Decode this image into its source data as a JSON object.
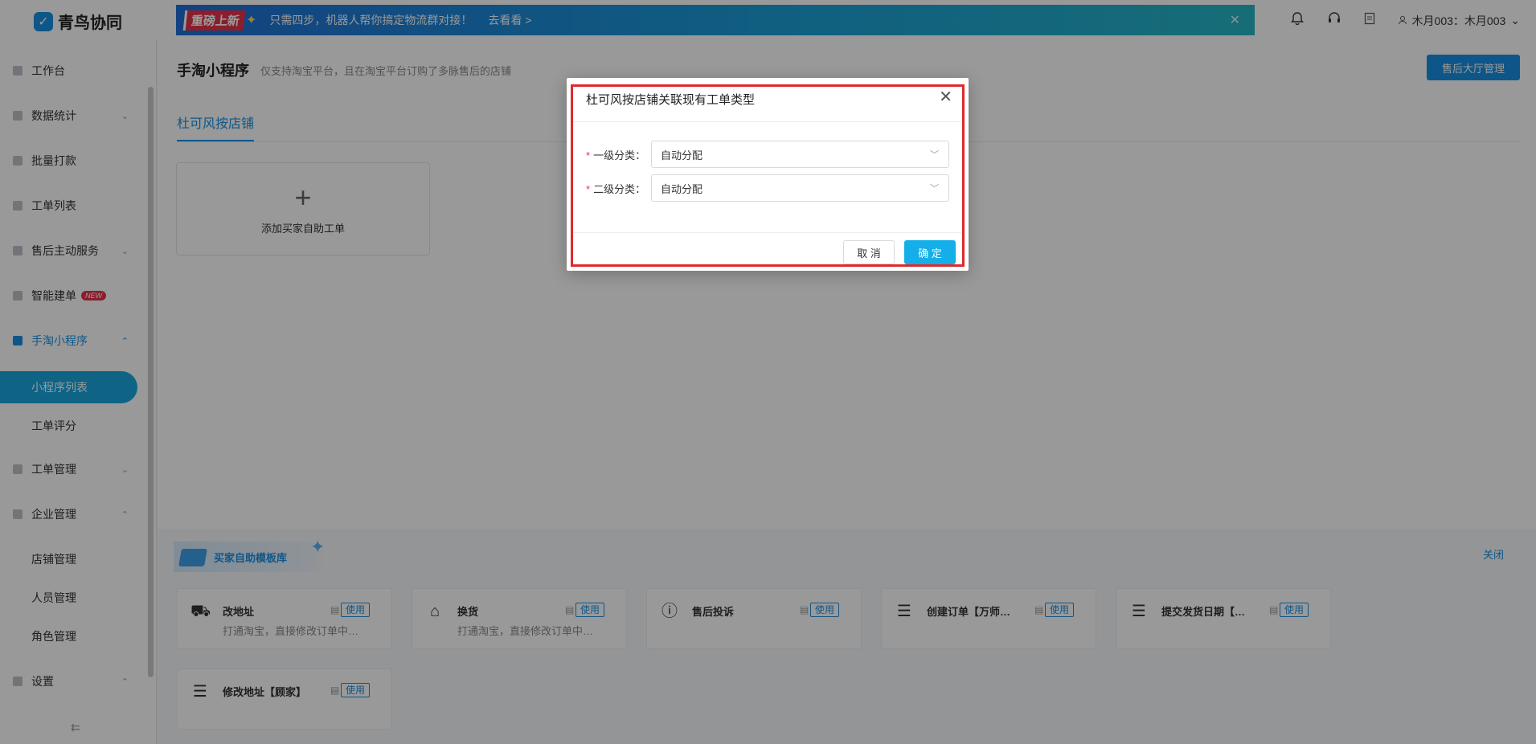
{
  "app": {
    "logo_mark": "✓",
    "logo_text": "青鸟协同"
  },
  "banner": {
    "tag": "重磅上新",
    "text": "只需四步，机器人帮你搞定物流群对接！",
    "link": "去看看 >",
    "close": "✕"
  },
  "topbar": {
    "user_label": "木月003：木月003",
    "user_chevron": "⌄"
  },
  "sidebar": {
    "items": [
      {
        "label": "工作台"
      },
      {
        "label": "数据统计",
        "chevron": "⌄"
      },
      {
        "label": "批量打款"
      },
      {
        "label": "工单列表"
      },
      {
        "label": "售后主动服务",
        "chevron": "⌄"
      },
      {
        "label": "智能建单",
        "badge": "NEW"
      },
      {
        "label": "手淘小程序",
        "chevron": "⌃"
      },
      {
        "label": "工单管理",
        "chevron": "⌄"
      },
      {
        "label": "企业管理",
        "chevron": "⌃"
      },
      {
        "label": "设置",
        "chevron": "⌃"
      }
    ],
    "sub_mini": [
      {
        "label": "小程序列表"
      },
      {
        "label": "工单评分"
      }
    ],
    "sub_enterprise": [
      {
        "label": "店铺管理"
      },
      {
        "label": "人员管理"
      },
      {
        "label": "角色管理"
      }
    ],
    "collapse": "⇇"
  },
  "main": {
    "title": "手淘小程序",
    "subtitle": "仅支持淘宝平台，且在淘宝平台订购了多脉售后的店铺",
    "hall_button": "售后大厅管理",
    "tab": "杜可风按店铺",
    "add_card": {
      "plus": "+",
      "label": "添加买家自助工单"
    }
  },
  "template_library": {
    "title": "买家自助模板库",
    "close": "关闭",
    "cards": [
      {
        "icon": "truck-icon",
        "glyph": "⛟",
        "name": "改地址",
        "desc": "打通淘宝，直接修改订单中…",
        "use": "使用"
      },
      {
        "icon": "home-icon",
        "glyph": "⌂",
        "name": "换货",
        "desc": "打通淘宝，直接修改订单中…",
        "use": "使用"
      },
      {
        "icon": "info-icon",
        "glyph": "ⓘ",
        "name": "售后投诉",
        "desc": "",
        "use": "使用"
      },
      {
        "icon": "form-icon",
        "glyph": "☰",
        "name": "创建订单【万师…",
        "desc": "",
        "use": "使用"
      },
      {
        "icon": "form-icon",
        "glyph": "☰",
        "name": "提交发货日期【…",
        "desc": "",
        "use": "使用"
      },
      {
        "icon": "form-icon",
        "glyph": "☰",
        "name": "修改地址【顾家】",
        "desc": "",
        "use": "使用"
      }
    ]
  },
  "modal": {
    "title": "杜可风按店铺关联现有工单类型",
    "close": "✕",
    "fields": [
      {
        "label": "一级分类：",
        "value": "自动分配"
      },
      {
        "label": "二级分类：",
        "value": "自动分配"
      }
    ],
    "required_mark": "*",
    "cancel": "取 消",
    "ok": "确 定"
  },
  "colors": {
    "accent": "#1a8fe3",
    "confirm": "#14aee8",
    "highlight": "#e02a2a"
  }
}
